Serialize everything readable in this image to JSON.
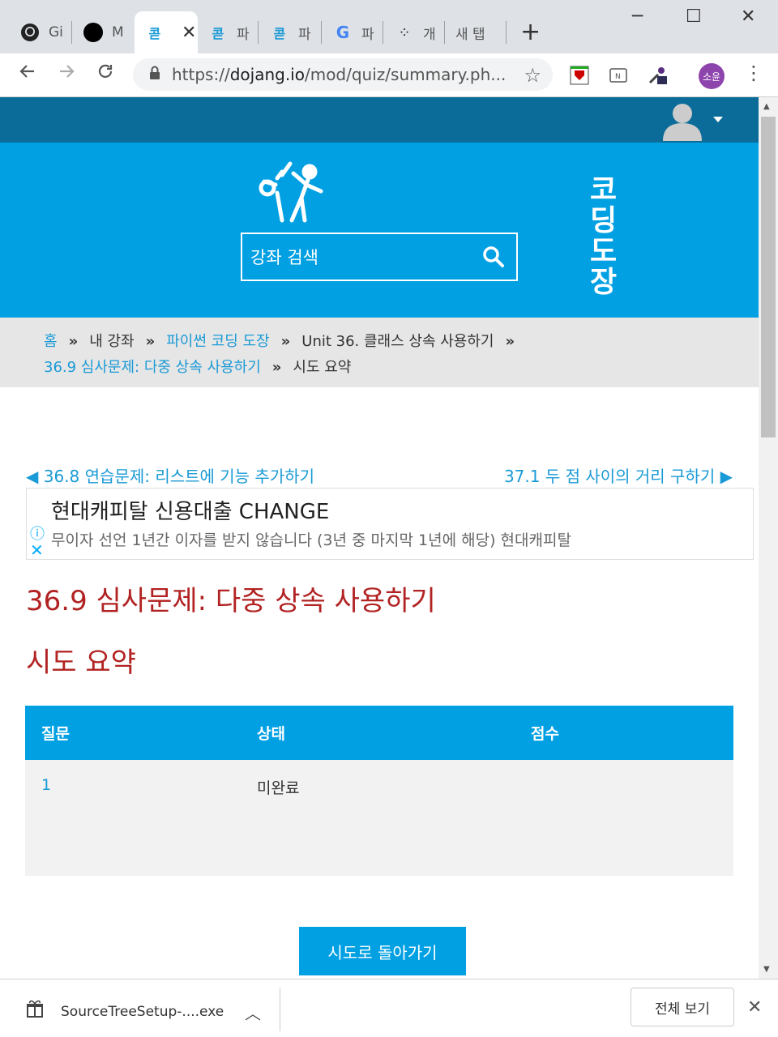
{
  "browser": {
    "tabs": [
      {
        "icon": "github-icon",
        "label": "Gi"
      },
      {
        "icon": "medium-icon",
        "label": "M"
      },
      {
        "icon": "dojang-icon",
        "label": "",
        "active": true,
        "close": "✕"
      },
      {
        "icon": "dojang-icon",
        "label": "파"
      },
      {
        "icon": "dojang-icon",
        "label": "파"
      },
      {
        "icon": "google-icon",
        "label": "파"
      },
      {
        "icon": "dots-icon",
        "label": "개"
      },
      {
        "icon": "",
        "label": "새 탭"
      }
    ],
    "new_tab": "+",
    "window_controls": {
      "minimize": "─",
      "maximize": "☐",
      "close": "✕"
    },
    "url_scheme": "https://",
    "url_host": "dojang.io",
    "url_path": "/mod/quiz/summary.ph...",
    "profile_initials": "소윤"
  },
  "page": {
    "search_placeholder": "강좌 검색",
    "logo_text_line1": "코딩",
    "logo_text_line2": "도장",
    "breadcrumb": {
      "home": "홈",
      "my_courses": "내 강좌",
      "course": "파이썬 코딩 도장",
      "unit": "Unit 36. 클래스 상속 사용하기",
      "quiz": "36.9 심사문제: 다중 상속 사용하기",
      "current": "시도 요약",
      "separator": "»"
    },
    "prev_link": "◀ 36.8 연습문제: 리스트에 기능 추가하기",
    "next_link": "37.1 두 점 사이의 거리 구하기 ▶",
    "ad": {
      "title": "현대캐피탈 신용대출 CHANGE",
      "description": "무이자 선언 1년간 이자를 받지 않습니다 (3년 중 마지막 1년에 해당) 현대캐피탈",
      "info_icon": "ⓘ",
      "close_icon": "✕"
    },
    "quiz_title": "36.9 심사문제: 다중 상속 사용하기",
    "summary_title": "시도 요약",
    "table": {
      "headers": [
        "질문",
        "상태",
        "점수"
      ],
      "rows": [
        {
          "question": "1",
          "status": "미완료",
          "score": ""
        }
      ]
    },
    "back_button": "시도로 돌아가기"
  },
  "downloads": {
    "filename": "SourceTreeSetup-....exe",
    "show_all": "전체 보기"
  },
  "colors": {
    "hero": "#00a0e3",
    "topnav": "#0b6c99",
    "heading": "#b22222",
    "link": "#1a9ad6"
  }
}
